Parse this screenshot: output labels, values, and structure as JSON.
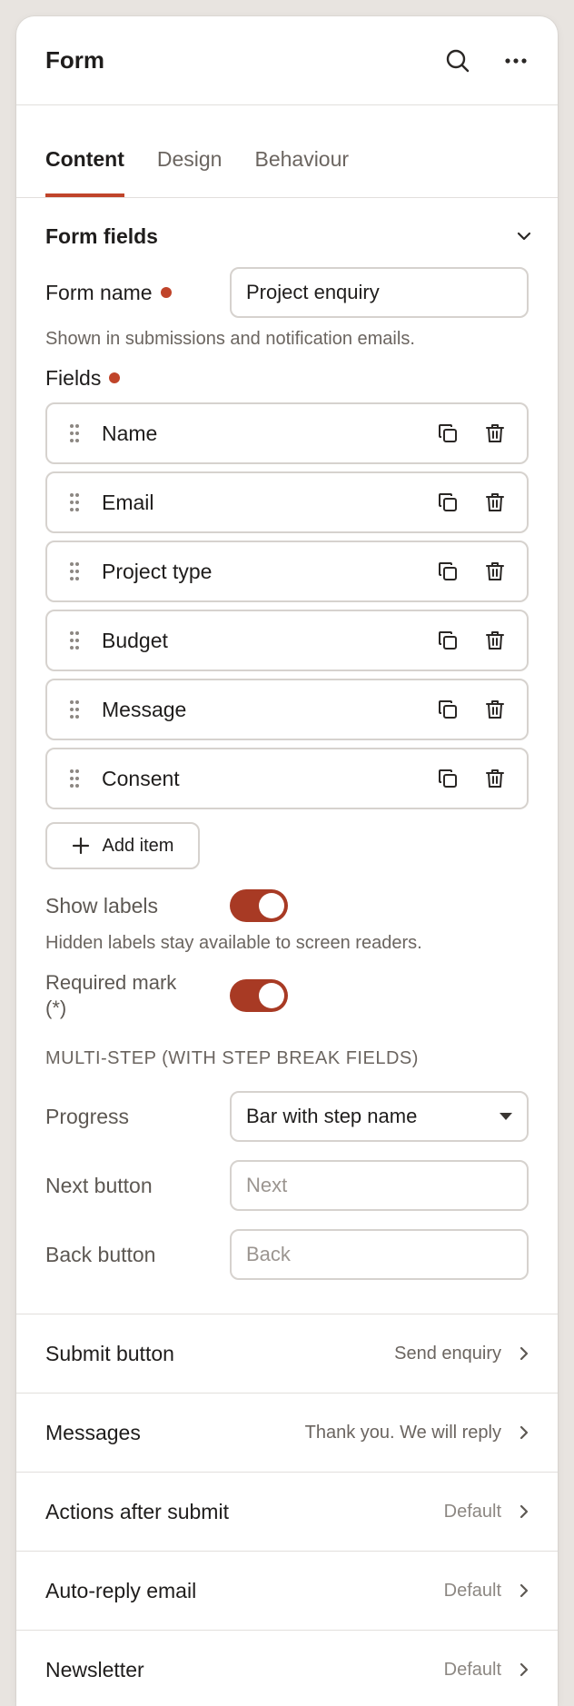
{
  "header": {
    "title": "Form",
    "search_icon": "search-icon",
    "more_icon": "more-horizontal-icon"
  },
  "tabs": [
    {
      "label": "Content",
      "active": true
    },
    {
      "label": "Design",
      "active": false
    },
    {
      "label": "Behaviour",
      "active": false
    }
  ],
  "form_fields_section": {
    "title": "Form fields",
    "expanded": true
  },
  "form_name": {
    "label": "Form name",
    "value": "Project enquiry",
    "hint": "Shown in submissions and notification emails."
  },
  "fields": {
    "label": "Fields",
    "items": [
      {
        "name": "Name"
      },
      {
        "name": "Email"
      },
      {
        "name": "Project type"
      },
      {
        "name": "Budget"
      },
      {
        "name": "Message"
      },
      {
        "name": "Consent"
      }
    ],
    "add_label": "Add item"
  },
  "show_labels": {
    "label": "Show labels",
    "on": true,
    "hint": "Hidden labels stay available to screen readers."
  },
  "required_mark": {
    "label_line1": "Required mark",
    "label_line2": "(*)",
    "on": true
  },
  "multistep": {
    "heading": "MULTI-STEP (WITH STEP BREAK FIELDS)",
    "progress_label": "Progress",
    "progress_value": "Bar with step name",
    "next_label": "Next button",
    "next_placeholder": "Next",
    "back_label": "Back button",
    "back_placeholder": "Back"
  },
  "nav_rows": [
    {
      "label": "Submit button",
      "value": "Send enquiry"
    },
    {
      "label": "Messages",
      "value": "Thank you. We will reply"
    },
    {
      "label": "Actions after submit",
      "value": "Default"
    },
    {
      "label": "Auto-reply email",
      "value": "Default"
    },
    {
      "label": "Newsletter",
      "value": "Default"
    }
  ],
  "colors": {
    "accent": "#c0442a",
    "toggle": "#a83a24",
    "border": "#d6d2ce"
  }
}
